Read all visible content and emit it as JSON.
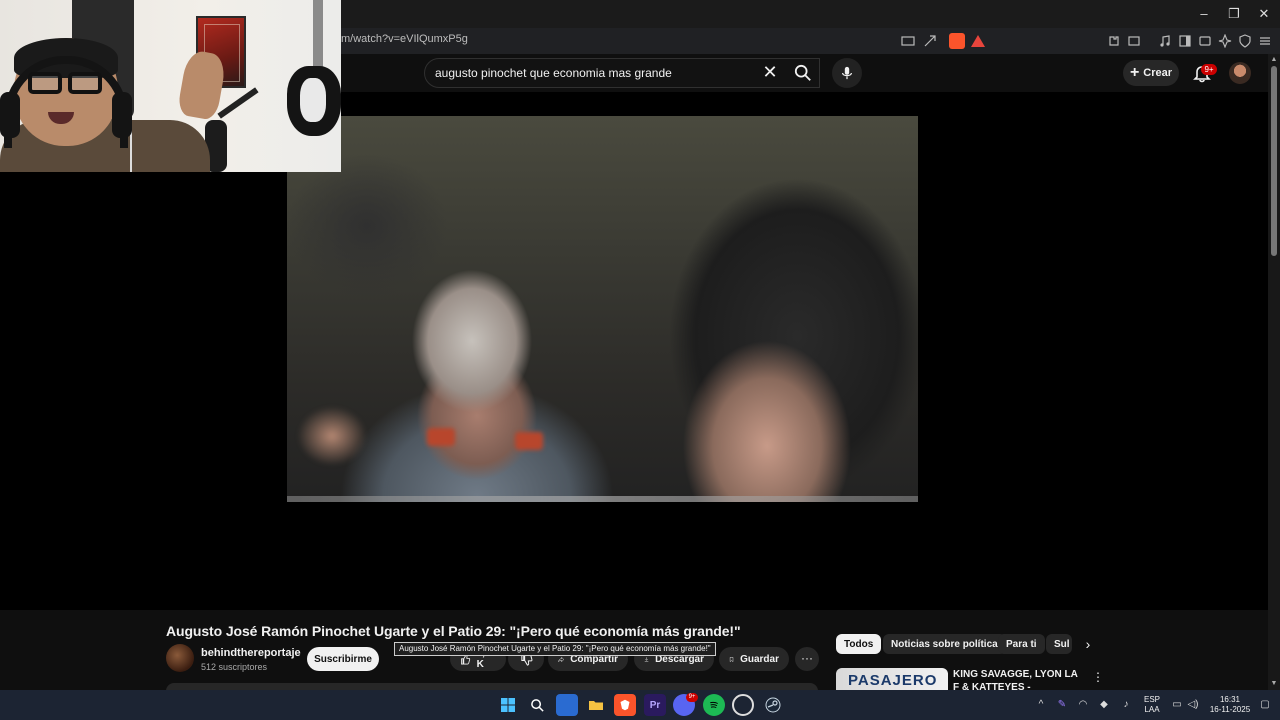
{
  "browser": {
    "url": "m/watch?v=eVIlQumxP5g",
    "window_controls": {
      "minimize": "–",
      "restore": "❐",
      "close": "✕"
    }
  },
  "youtube": {
    "search": {
      "value": "augusto pinochet que economia mas grande"
    },
    "create_label": "Crear",
    "notifications_badge": "9+"
  },
  "video": {
    "title": "Augusto José Ramón Pinochet Ugarte y el Patio 29: \"¡Pero qué economía más grande!\"",
    "tooltip": "Augusto José Ramón Pinochet Ugarte y el Patio 29: \"¡Pero qué economía más grande!\"",
    "channel_name": "behindthereportaje",
    "subscribers": "512 suscriptores",
    "subscribe_label": "Suscribirme",
    "likes": "9,7 K",
    "share_label": "Compartir",
    "download_label": "Descargar",
    "save_label": "Guardar",
    "more_label": "···"
  },
  "sidebar": {
    "chips": [
      "Todos",
      "Noticias sobre política",
      "Para ti",
      "Sul"
    ],
    "recommendation": {
      "thumb_text": "PASAJERO",
      "title": "KING SAVAGGE, LYON LA F & KATTEYES - PASAJERO FT."
    }
  },
  "taskbar": {
    "language": "ESP",
    "layout": "LAA",
    "time": "16:31",
    "date": "16-11-2025",
    "discord_badge": "9+"
  },
  "colors": {
    "background": "#0f0f0f",
    "accent_red": "#cc0000",
    "brave_orange": "#fb542b",
    "taskbar": "#1c2433"
  }
}
